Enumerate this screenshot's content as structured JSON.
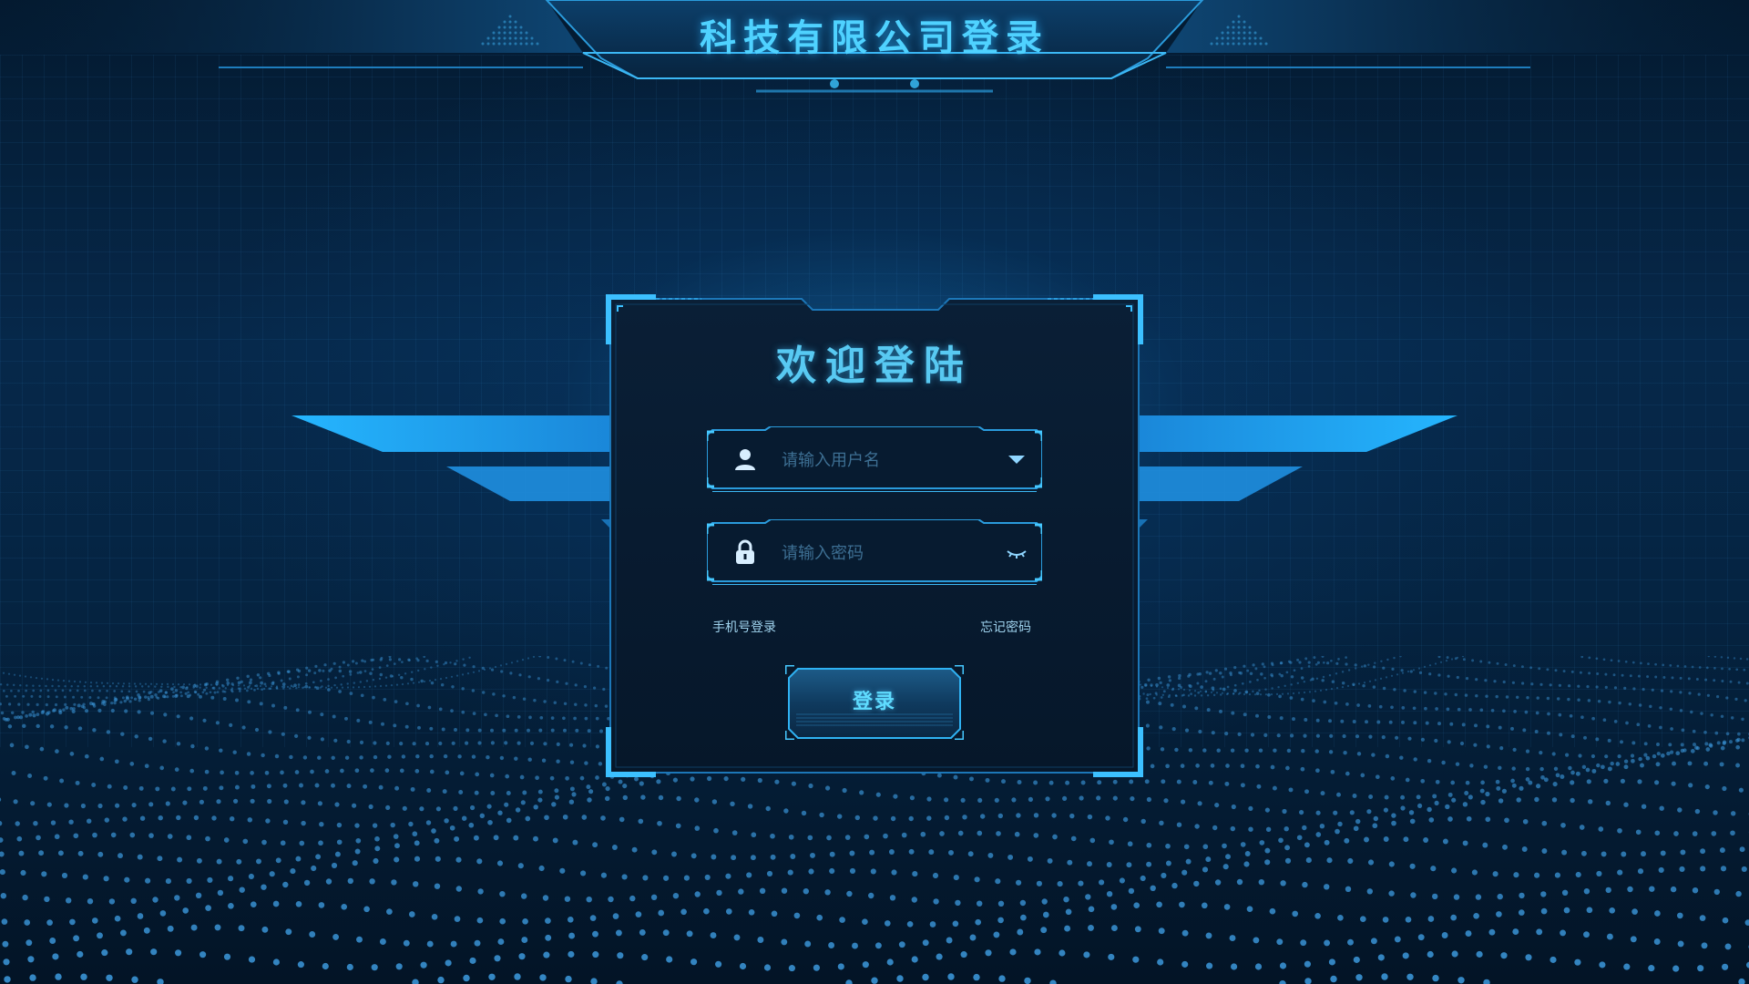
{
  "header": {
    "title": "科技有限公司登录"
  },
  "login": {
    "welcome": "欢迎登陆",
    "username": {
      "value": "",
      "placeholder": "请输入用户名"
    },
    "password": {
      "value": "",
      "placeholder": "请输入密码"
    },
    "phone_login_label": "手机号登录",
    "forgot_password_label": "忘记密码",
    "submit_label": "登录"
  },
  "icons": {
    "user": "user-icon",
    "dropdown": "chevron-down-icon",
    "lock": "lock-icon",
    "eye": "eye-closed-icon"
  },
  "colors": {
    "accent": "#4fd2ff",
    "frame": "#29a8ee",
    "panel_bg": "#071a2e",
    "background": "#052442"
  }
}
